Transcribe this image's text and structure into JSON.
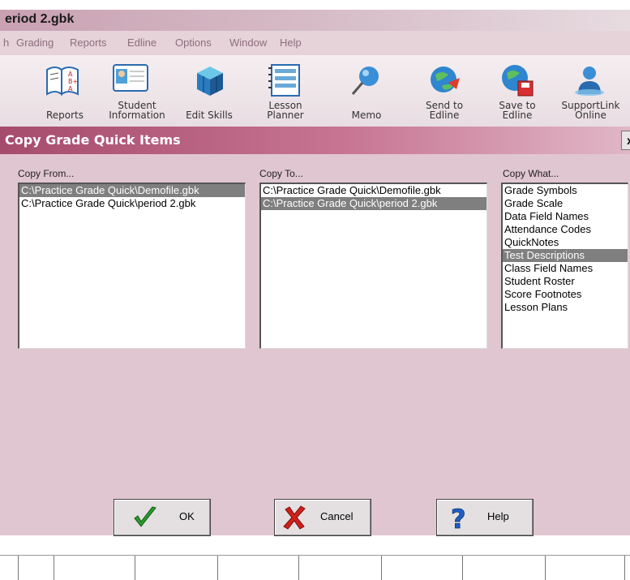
{
  "window": {
    "title": "eriod 2.gbk"
  },
  "menu": [
    "h",
    "Grading",
    "Reports",
    "Edline",
    "Options",
    "Window",
    "Help"
  ],
  "toolbar": [
    {
      "label1": "",
      "label2": "Reports",
      "icon": "reports-icon"
    },
    {
      "label1": "Student",
      "label2": "Information",
      "icon": "student-information-icon"
    },
    {
      "label1": "",
      "label2": "Edit Skills",
      "icon": "edit-skills-icon"
    },
    {
      "label1": "Lesson",
      "label2": "Planner",
      "icon": "lesson-planner-icon"
    },
    {
      "label1": "",
      "label2": "Memo",
      "icon": "memo-icon"
    },
    {
      "label1": "Send to",
      "label2": "Edline",
      "icon": "send-to-edline-icon"
    },
    {
      "label1": "Save to",
      "label2": "Edline",
      "icon": "save-to-edline-icon"
    },
    {
      "label1": "SupportLink",
      "label2": "Online",
      "icon": "supportlink-icon"
    }
  ],
  "dialog": {
    "title": "Copy Grade Quick Items",
    "close": "x",
    "copy_from": {
      "label": "Copy From...",
      "items": [
        "C:\\Practice Grade Quick\\Demofile.gbk",
        "C:\\Practice Grade Quick\\period 2.gbk"
      ],
      "selected_index": 0
    },
    "copy_to": {
      "label": "Copy To...",
      "items": [
        "C:\\Practice Grade Quick\\Demofile.gbk",
        "C:\\Practice Grade Quick\\period 2.gbk"
      ],
      "selected_index": 1
    },
    "copy_what": {
      "label": "Copy What...",
      "items": [
        "Grade Symbols",
        "Grade Scale",
        "Data Field Names",
        "Attendance Codes",
        "QuickNotes",
        "Test Descriptions",
        "Class Field Names",
        "Student Roster",
        "Score Footnotes",
        "Lesson Plans"
      ],
      "selected_index": 5
    },
    "buttons": {
      "ok": "OK",
      "cancel": "Cancel",
      "help": "Help"
    }
  },
  "colors": {
    "dialog_bg": "#e0c6d0",
    "title_gradient_start": "#a64b6c",
    "selection": "#7f7f7f"
  }
}
